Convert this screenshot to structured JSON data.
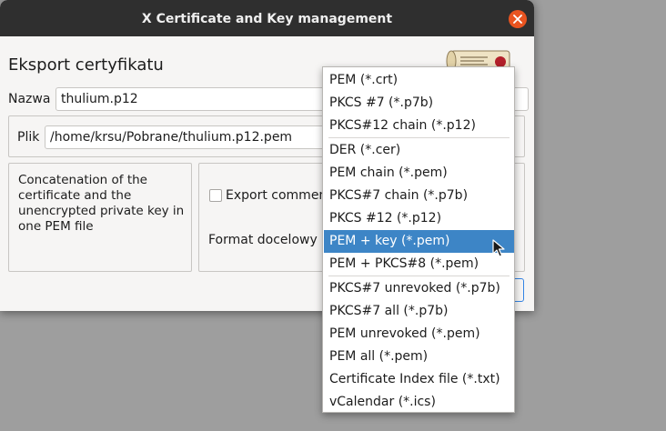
{
  "window": {
    "title": "X Certificate and Key management"
  },
  "dialog": {
    "heading": "Eksport certyfikatu",
    "name_label": "Nazwa",
    "name_value": "thulium.p12",
    "file_label": "Plik",
    "file_value": "/home/krsu/Pobrane/thulium.p12.pem",
    "description": "Concatenation of the certificate and the unencrypted private key in one PEM file",
    "export_comment_label": "Export commen",
    "format_label": "Format docelowy"
  },
  "format_menu": {
    "options": [
      "PEM (*.crt)",
      "PKCS #7 (*.p7b)",
      "PKCS#12 chain (*.p12)",
      "DER (*.cer)",
      "PEM chain (*.pem)",
      "PKCS#7 chain (*.p7b)",
      "PKCS #12 (*.p12)",
      "PEM + key (*.pem)",
      "PEM + PKCS#8 (*.pem)",
      "PKCS#7 unrevoked (*.p7b)",
      "PKCS#7 all (*.p7b)",
      "PEM unrevoked (*.pem)",
      "PEM all (*.pem)",
      "Certificate Index file (*.txt)",
      "vCalendar (*.ics)"
    ],
    "selected": "PEM + key (*.pem)"
  },
  "colors": {
    "accent": "#3d85c6",
    "close": "#e95420",
    "titlebar": "#2f2f2f"
  },
  "icons": {
    "close": "close-icon",
    "logo": "certificate-scroll-icon",
    "pointer": "mouse-pointer-icon"
  }
}
